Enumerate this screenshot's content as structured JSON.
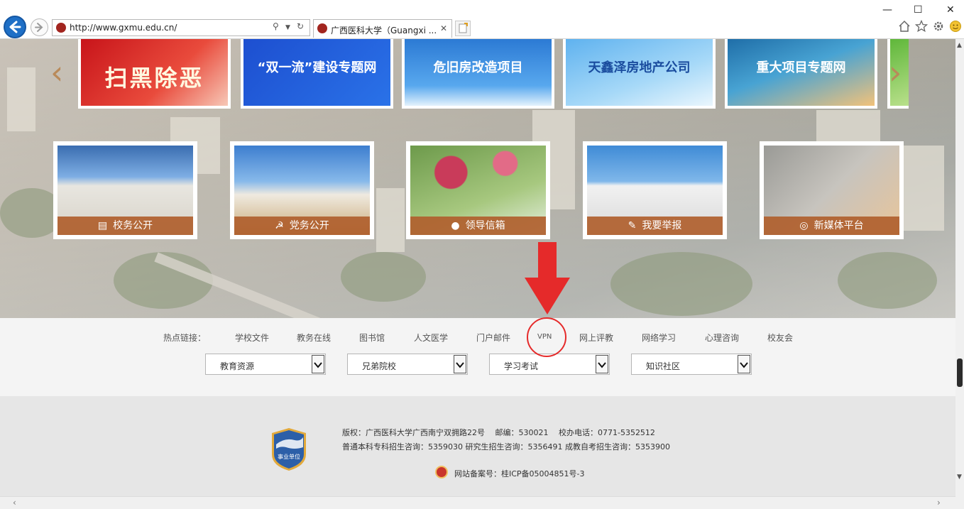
{
  "browser": {
    "url": "http://www.gxmu.edu.cn/",
    "tab_title": "广西医科大学（Guangxi ...",
    "tab_close": "✕",
    "window_controls": [
      "—",
      "☐",
      "✕"
    ],
    "toolbar_icons": [
      "home-icon",
      "star-icon",
      "gear-icon",
      "smiley-icon"
    ]
  },
  "banners": [
    {
      "label": "扫黑除恶"
    },
    {
      "label": "“双一流”建设专题网"
    },
    {
      "label": "危旧房改造项目"
    },
    {
      "label": "天鑫泽房地产公司"
    },
    {
      "label": "重大项目专题网"
    }
  ],
  "cards": [
    {
      "label": "校务公开",
      "icon": "document-icon"
    },
    {
      "label": "党务公开",
      "icon": "party-icon"
    },
    {
      "label": "领导信箱",
      "icon": "person-icon"
    },
    {
      "label": "我要举报",
      "icon": "edit-icon"
    },
    {
      "label": "新媒体平台",
      "icon": "wechat-icon"
    }
  ],
  "hot_links": {
    "label": "热点链接：",
    "items": [
      "学校文件",
      "教务在线",
      "图书馆",
      "人文医学",
      "门户邮件",
      "VPN",
      "网上评教",
      "网络学习",
      "心理咨询",
      "校友会"
    ]
  },
  "selects": [
    {
      "value": "教育资源"
    },
    {
      "value": "兄弟院校"
    },
    {
      "value": "学习考试"
    },
    {
      "value": "知识社区"
    }
  ],
  "footer": {
    "badge_text": "事业单位",
    "line1": "版权：广西医科大学广西南宁双拥路22号　 邮编：530021　 校办电话：0771-5352512",
    "line2": "普通本科专科招生咨询：5359030 研究生招生咨询：5356491 成教自考招生咨询：5353900",
    "icp": "网站备案号：桂ICP备05004851号-3"
  },
  "colors": {
    "accent_blue": "#1e6fc6",
    "card_caption": "#b0602e",
    "annotation_red": "#e52a2a"
  }
}
